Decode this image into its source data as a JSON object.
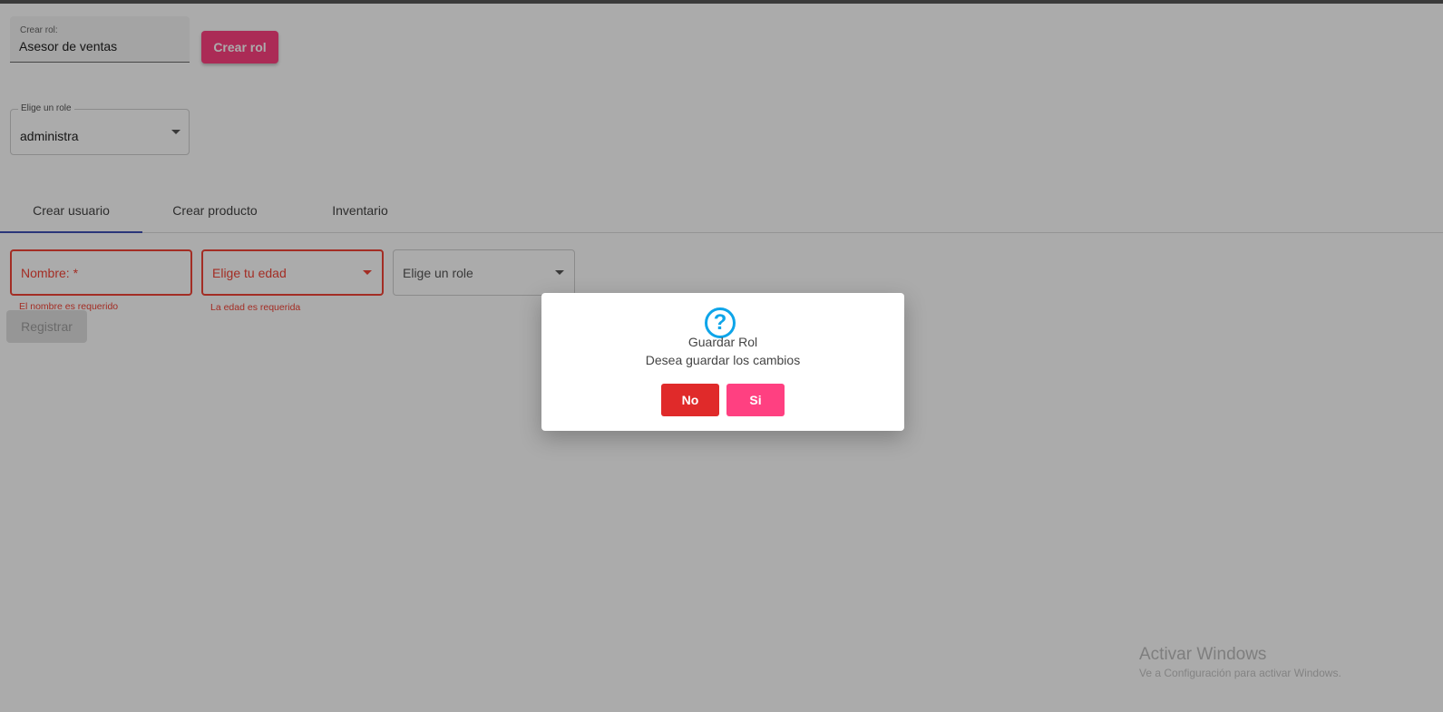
{
  "crear_rol": {
    "label": "Crear rol:",
    "value": "Asesor de ventas",
    "button_label": "Crear rol"
  },
  "role_select": {
    "label": "Elige un role",
    "value": "administra"
  },
  "tabs": [
    {
      "label": "Crear usuario",
      "active": true
    },
    {
      "label": "Crear producto",
      "active": false
    },
    {
      "label": "Inventario",
      "active": false
    }
  ],
  "form": {
    "nombre_placeholder": "Nombre: *",
    "nombre_error": "El nombre es requerido",
    "edad_placeholder": "Elige tu edad",
    "edad_error": "La edad es requerida",
    "role_placeholder": "Elige un role",
    "registrar_label": "Registrar"
  },
  "dialog": {
    "icon": "question-icon",
    "title": "Guardar Rol",
    "text": "Desea guardar los cambios",
    "no_label": "No",
    "si_label": "Si"
  },
  "watermark": {
    "line1": "Activar Windows",
    "line2": "Ve a Configuración para activar Windows."
  },
  "colors": {
    "accent_pink": "#ff4081",
    "error_red": "#f44336",
    "no_button_red": "#e02a2a",
    "tab_indicator": "#3f51b5",
    "question_icon": "#0ea5e9"
  }
}
